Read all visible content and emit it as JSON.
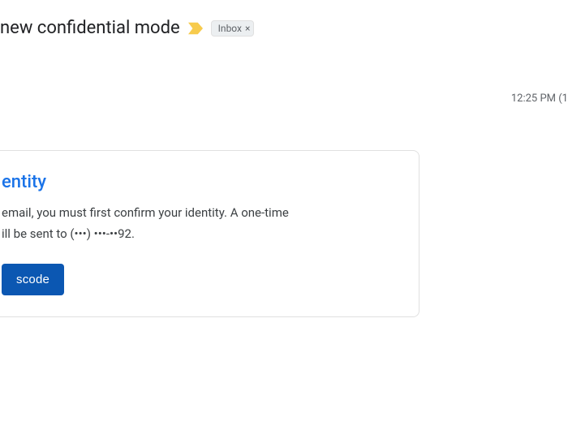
{
  "header": {
    "subject": "new confidential mode",
    "label": "Inbox",
    "timestamp": "12:25 PM (1"
  },
  "card": {
    "title_visible": "entity",
    "body_line1": "email, you must first confirm your identity. A one-time",
    "body_line2": "ill be sent to (•••) •••-••92.",
    "button_visible": "scode"
  },
  "colors": {
    "accent_blue": "#1a73e8",
    "button_blue": "#0b57b2",
    "chip_bg": "#eceff1",
    "importance_yellow": "#f7cb4d",
    "text_secondary": "#5f6368"
  }
}
